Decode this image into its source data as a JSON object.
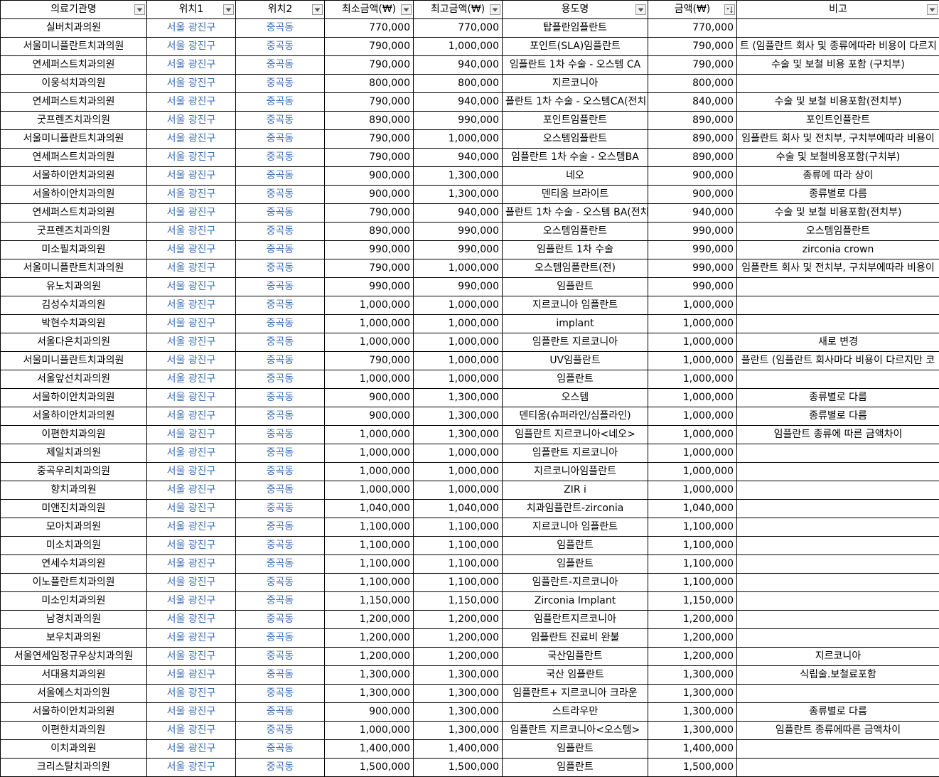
{
  "headers": [
    {
      "label": "의료기관명",
      "filter": "filter"
    },
    {
      "label": "위치1",
      "filter": "filter"
    },
    {
      "label": "위치2",
      "filter": "filter"
    },
    {
      "label": "최소금액(₩)",
      "filter": "filter"
    },
    {
      "label": "최고금액(₩)",
      "filter": "filter"
    },
    {
      "label": "용도명",
      "filter": "filter"
    },
    {
      "label": "금액(₩)",
      "filter": "sort-ascending"
    },
    {
      "label": "비고",
      "filter": "filter"
    }
  ],
  "colors": {
    "location_text": "#3e6fb8",
    "border": "#000000"
  },
  "rows": [
    [
      "실버치과의원",
      "서울 광진구",
      "중곡동",
      "770,000",
      "770,000",
      "탑플란임플란트",
      "770,000",
      ""
    ],
    [
      "서울미니플란트치과의원",
      "서울 광진구",
      "중곡동",
      "790,000",
      "1,000,000",
      "포인트(SLA)임플란트",
      "790,000",
      "트 (임플란트 회사 및 종류에따라 비용이 다르지"
    ],
    [
      "연세퍼스트치과의원",
      "서울 광진구",
      "중곡동",
      "790,000",
      "940,000",
      "임플란트 1차 수술 - 오스템 CA",
      "790,000",
      "수술 및 보철 비용 포함 (구치부)"
    ],
    [
      "이웅석치과의원",
      "서울 광진구",
      "중곡동",
      "800,000",
      "800,000",
      "지르코니아",
      "800,000",
      ""
    ],
    [
      "연세퍼스트치과의원",
      "서울 광진구",
      "중곡동",
      "790,000",
      "940,000",
      "플란트 1차 수술 - 오스템CA(전치",
      "840,000",
      "수술 및 보철 비용포함(전치부)"
    ],
    [
      "굿프렌즈치과의원",
      "서울 광진구",
      "중곡동",
      "890,000",
      "990,000",
      "포인트임플란트",
      "890,000",
      "포인트인플란트"
    ],
    [
      "서울미니플란트치과의원",
      "서울 광진구",
      "중곡동",
      "790,000",
      "1,000,000",
      "오스템임플란트",
      "890,000",
      "임플란트 회사 및 전치부, 구치부에따라 비용이"
    ],
    [
      "연세퍼스트치과의원",
      "서울 광진구",
      "중곡동",
      "790,000",
      "940,000",
      "임플란트 1차 수술 - 오스템BA",
      "890,000",
      "수술 및 보철비용포함(구치부)"
    ],
    [
      "서울하이안치과의원",
      "서울 광진구",
      "중곡동",
      "900,000",
      "1,300,000",
      "네오",
      "900,000",
      "종류에 따라 상이"
    ],
    [
      "서울하이안치과의원",
      "서울 광진구",
      "중곡동",
      "900,000",
      "1,300,000",
      "덴티움 브라이트",
      "900,000",
      "종류별로 다름"
    ],
    [
      "연세퍼스트치과의원",
      "서울 광진구",
      "중곡동",
      "790,000",
      "940,000",
      "플란트 1차 수술 - 오스템 BA(전치",
      "940,000",
      "수술 및 보철 비용포함(전치부)"
    ],
    [
      "굿프렌즈치과의원",
      "서울 광진구",
      "중곡동",
      "890,000",
      "990,000",
      "오스템임플란트",
      "990,000",
      "오스템임플란트"
    ],
    [
      "미소필치과의원",
      "서울 광진구",
      "중곡동",
      "990,000",
      "990,000",
      "임플란트 1차 수술",
      "990,000",
      "zirconia crown"
    ],
    [
      "서울미니플란트치과의원",
      "서울 광진구",
      "중곡동",
      "790,000",
      "1,000,000",
      "오스템임플란트(전)",
      "990,000",
      "임플란트 회사 및 전치부, 구치부에따라 비용이"
    ],
    [
      "유노치과의원",
      "서울 광진구",
      "중곡동",
      "990,000",
      "990,000",
      "임플란트",
      "990,000",
      ""
    ],
    [
      "김성수치과의원",
      "서울 광진구",
      "중곡동",
      "1,000,000",
      "1,000,000",
      "지르코니아 임플란트",
      "1,000,000",
      ""
    ],
    [
      "박현수치과의원",
      "서울 광진구",
      "중곡동",
      "1,000,000",
      "1,000,000",
      "implant",
      "1,000,000",
      ""
    ],
    [
      "서울다은치과의원",
      "서울 광진구",
      "중곡동",
      "1,000,000",
      "1,000,000",
      "임플란트 지르코니아",
      "1,000,000",
      "새로 변경"
    ],
    [
      "서울미니플란트치과의원",
      "서울 광진구",
      "중곡동",
      "790,000",
      "1,000,000",
      "UV임플란트",
      "1,000,000",
      "플란트 (임플란트 회사마다 비용이 다르지만 코"
    ],
    [
      "서울앞선치과의원",
      "서울 광진구",
      "중곡동",
      "1,000,000",
      "1,000,000",
      "임플란트",
      "1,000,000",
      ""
    ],
    [
      "서울하이안치과의원",
      "서울 광진구",
      "중곡동",
      "900,000",
      "1,300,000",
      "오스템",
      "1,000,000",
      "종류별로 다름"
    ],
    [
      "서울하이안치과의원",
      "서울 광진구",
      "중곡동",
      "900,000",
      "1,300,000",
      "덴티움(슈퍼라인/심플라인)",
      "1,000,000",
      "종류별로 다름"
    ],
    [
      "이편한치과의원",
      "서울 광진구",
      "중곡동",
      "1,000,000",
      "1,300,000",
      "임플란트 지르코니아<네오>",
      "1,000,000",
      "임플란트 종류에 따른 금액차이"
    ],
    [
      "제일치과의원",
      "서울 광진구",
      "중곡동",
      "1,000,000",
      "1,000,000",
      "임플란트 지르코니아",
      "1,000,000",
      ""
    ],
    [
      "중곡우리치과의원",
      "서울 광진구",
      "중곡동",
      "1,000,000",
      "1,000,000",
      "지르코니아임플란트",
      "1,000,000",
      ""
    ],
    [
      "향치과의원",
      "서울 광진구",
      "중곡동",
      "1,000,000",
      "1,000,000",
      "ZIR i",
      "1,000,000",
      ""
    ],
    [
      "미앤진치과의원",
      "서울 광진구",
      "중곡동",
      "1,040,000",
      "1,040,000",
      "치과임플란트-zirconia",
      "1,040,000",
      ""
    ],
    [
      "모아치과의원",
      "서울 광진구",
      "중곡동",
      "1,100,000",
      "1,100,000",
      "지르코니아 임플란트",
      "1,100,000",
      ""
    ],
    [
      "미소치과의원",
      "서울 광진구",
      "중곡동",
      "1,100,000",
      "1,100,000",
      "임플란트",
      "1,100,000",
      ""
    ],
    [
      "연세수치과의원",
      "서울 광진구",
      "중곡동",
      "1,100,000",
      "1,100,000",
      "임플란트",
      "1,100,000",
      ""
    ],
    [
      "이노플란트치과의원",
      "서울 광진구",
      "중곡동",
      "1,100,000",
      "1,100,000",
      "임플란트-지르코니아",
      "1,100,000",
      ""
    ],
    [
      "미소인치과의원",
      "서울 광진구",
      "중곡동",
      "1,150,000",
      "1,150,000",
      "Zirconia Implant",
      "1,150,000",
      ""
    ],
    [
      "남경치과의원",
      "서울 광진구",
      "중곡동",
      "1,200,000",
      "1,200,000",
      "임플란트지르코니아",
      "1,200,000",
      ""
    ],
    [
      "보우치과의원",
      "서울 광진구",
      "중곡동",
      "1,200,000",
      "1,200,000",
      "임플란트 진료비 완불",
      "1,200,000",
      ""
    ],
    [
      "서울연세임정규우상치과의원",
      "서울 광진구",
      "중곡동",
      "1,200,000",
      "1,200,000",
      "국산임플란트",
      "1,200,000",
      "지르코니아"
    ],
    [
      "서대용치과의원",
      "서울 광진구",
      "중곡동",
      "1,300,000",
      "1,300,000",
      "국산 임플란트",
      "1,300,000",
      "식립술.보철료포함"
    ],
    [
      "서울에스치과의원",
      "서울 광진구",
      "중곡동",
      "1,300,000",
      "1,300,000",
      "임플란트+ 지르코니아 크라운",
      "1,300,000",
      ""
    ],
    [
      "서울하이안치과의원",
      "서울 광진구",
      "중곡동",
      "900,000",
      "1,300,000",
      "스트라우만",
      "1,300,000",
      "종류별로 다름"
    ],
    [
      "이편한치과의원",
      "서울 광진구",
      "중곡동",
      "1,000,000",
      "1,300,000",
      "임플란트 지르코니아<오스템>",
      "1,300,000",
      "임플란트 종류에따른 금액차이"
    ],
    [
      "이치과의원",
      "서울 광진구",
      "중곡동",
      "1,400,000",
      "1,400,000",
      "임플란트",
      "1,400,000",
      ""
    ],
    [
      "크리스탈치과의원",
      "서울 광진구",
      "중곡동",
      "1,500,000",
      "1,500,000",
      "임플란트",
      "1,500,000",
      ""
    ]
  ]
}
